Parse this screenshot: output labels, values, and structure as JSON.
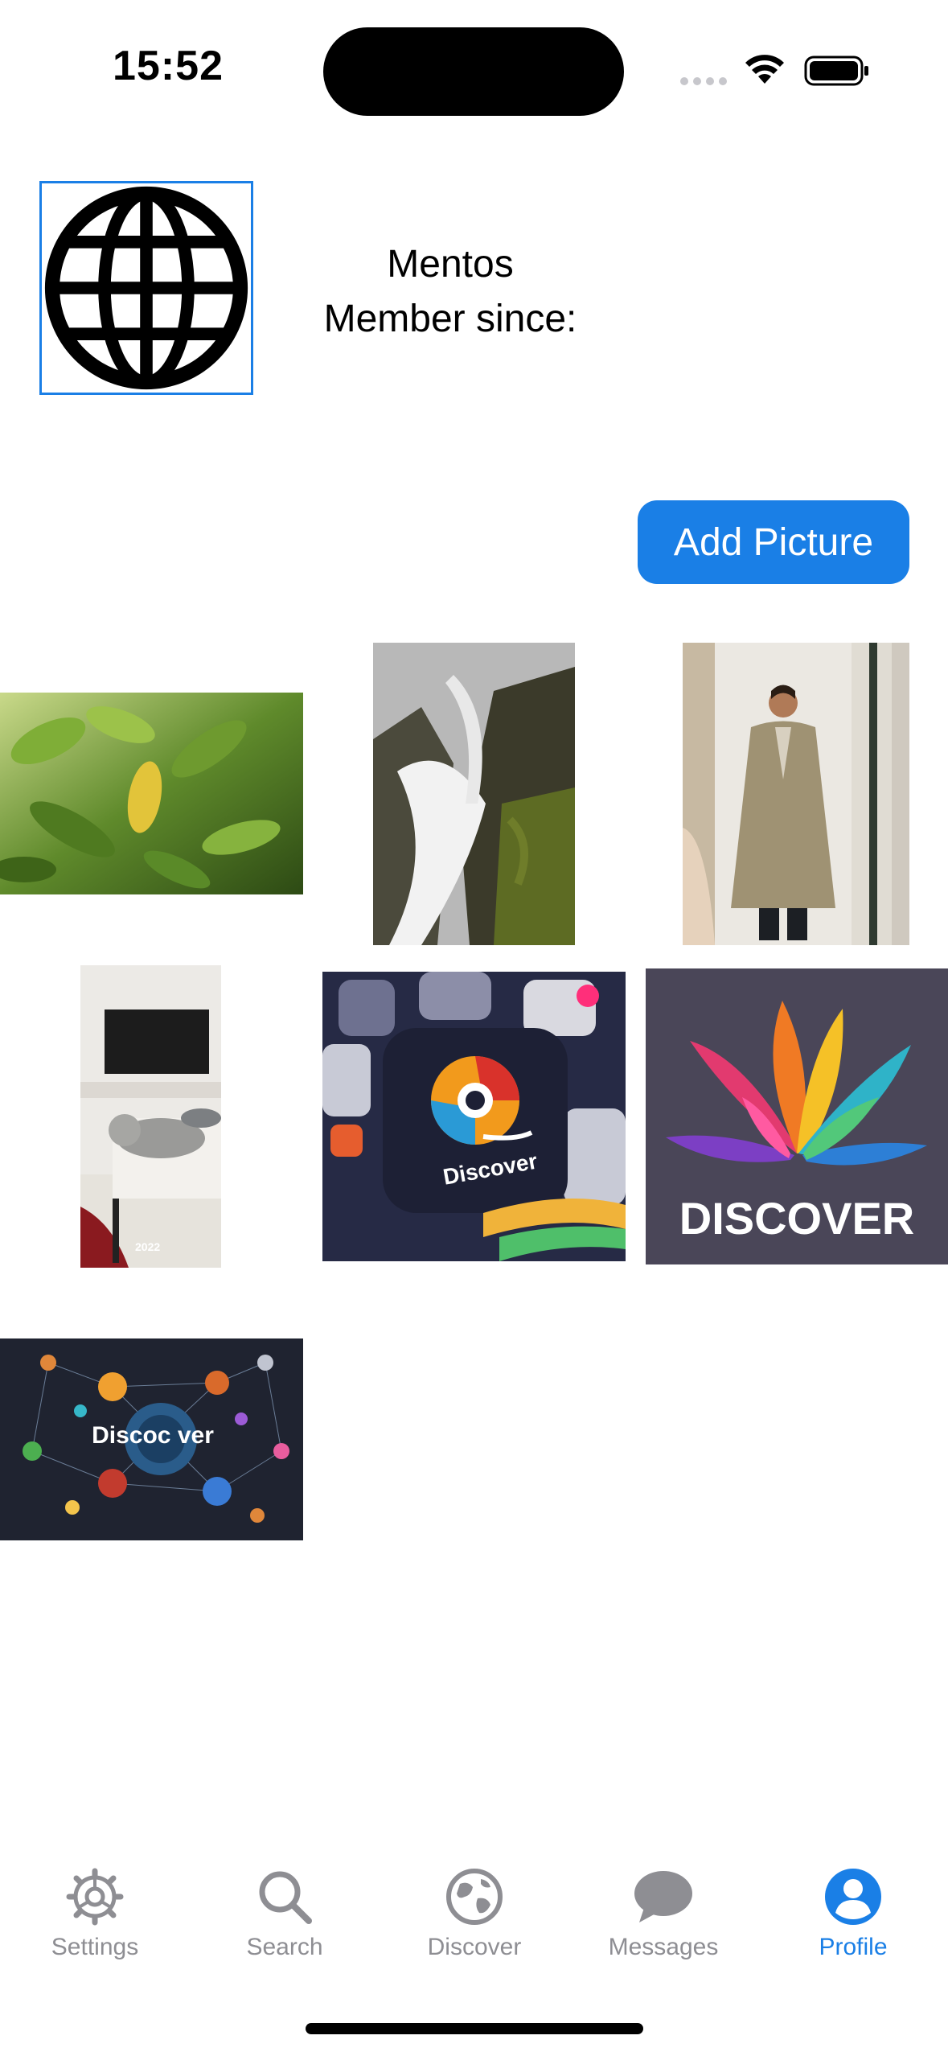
{
  "status_bar": {
    "time": "15:52"
  },
  "profile": {
    "avatar_icon": "globe-icon",
    "name": "Mentos",
    "member_since_label": "Member since:"
  },
  "actions": {
    "add_picture_label": "Add Picture"
  },
  "photos": [
    {
      "subject": "green leaves",
      "caption": ""
    },
    {
      "subject": "waterfall over mossy rock",
      "caption": ""
    },
    {
      "subject": "man in trench coat mirror selfie",
      "caption": ""
    },
    {
      "subject": "cat on table in living room",
      "caption": "2022"
    },
    {
      "subject": "Discover app icon",
      "caption": "Discover"
    },
    {
      "subject": "Discover colorful logo",
      "caption": "DISCOVER"
    },
    {
      "subject": "Discover network graphic",
      "caption": "Discoc ver"
    }
  ],
  "tab_bar": {
    "tabs": [
      {
        "label": "Settings",
        "icon": "gear-icon",
        "active": false
      },
      {
        "label": "Search",
        "icon": "search-icon",
        "active": false
      },
      {
        "label": "Discover",
        "icon": "globe-icon",
        "active": false
      },
      {
        "label": "Messages",
        "icon": "message-bubble-icon",
        "active": false
      },
      {
        "label": "Profile",
        "icon": "person-circle-icon",
        "active": true
      }
    ]
  },
  "colors": {
    "accent": "#1a7fe6",
    "inactive": "#8e8e93"
  }
}
